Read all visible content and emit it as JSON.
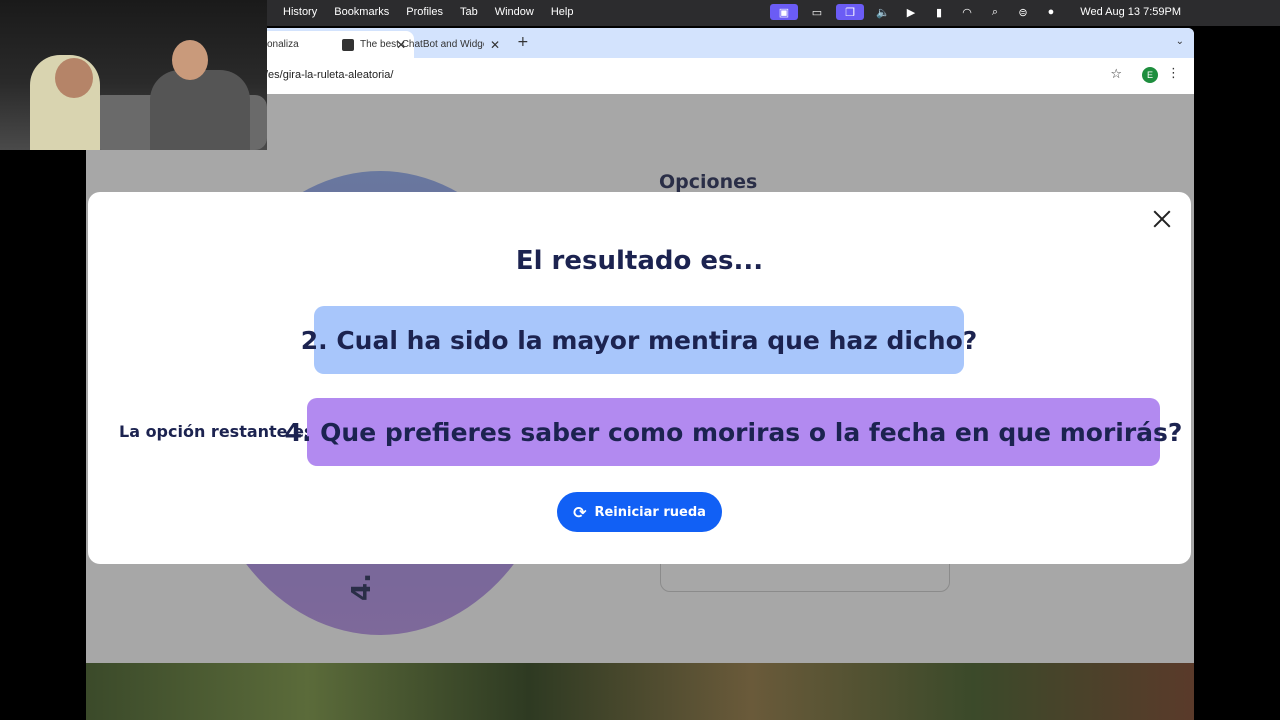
{
  "menubar": {
    "menus": [
      "History",
      "Bookmarks",
      "Profiles",
      "Tab",
      "Window",
      "Help"
    ],
    "clock": "Wed Aug 13  7:59PM",
    "status_icons": [
      "screen-share-icon",
      "display-icon",
      "window-icon",
      "volume-icon",
      "play-icon",
      "battery-icon",
      "wifi-icon",
      "search-icon",
      "control-center-icon",
      "siri-icon"
    ]
  },
  "browser": {
    "tabs": [
      {
        "label": "sonaliza",
        "active": true
      },
      {
        "label": "The best ChatBot and Widget",
        "active": false
      }
    ],
    "url": "/es/gira-la-ruleta-aleatoria/",
    "profile_initial": "E"
  },
  "page": {
    "options_title": "Opciones",
    "wheel_label": "4."
  },
  "modal": {
    "title": "El resultado es...",
    "result": "2. Cual ha sido la mayor mentira que haz dicho?",
    "remaining_label": "La opción restante es",
    "remaining": "4. Que prefieres saber como moriras o la fecha en que morirás?",
    "reset_button": "Reiniciar rueda"
  },
  "colors": {
    "result_box": "#a8c6fb",
    "remaining_box": "#b28af0",
    "reset_button": "#1160f5",
    "text_dark": "#1c2350"
  }
}
